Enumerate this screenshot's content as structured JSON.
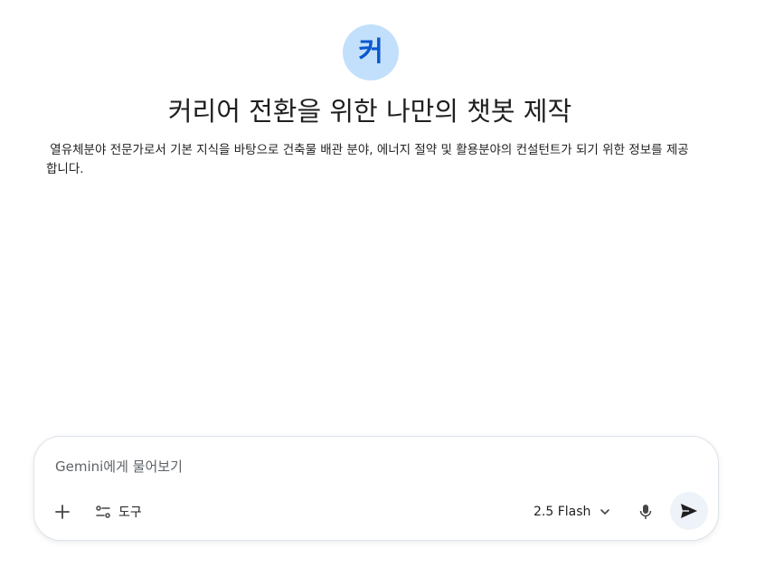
{
  "gem": {
    "avatar_letter": "커",
    "title": "커리어 전환을 위한 나만의 챗봇 제작",
    "description": " 열유체분야 전문가로서 기본 지식을 바탕으로 건축물 배관 분야, 에너지 절약 및 활용분야의 컨설턴트가 되기 위한 정보를 제공합니다.",
    "avatar_color": "#c2e0fb",
    "avatar_text_color": "#0b57d0"
  },
  "composer": {
    "placeholder": "Gemini에게 물어보기",
    "add_icon": "plus-icon",
    "tools_icon": "tune-icon",
    "tools_label": "도구",
    "model_label": "2.5 Flash",
    "model_icon": "chevron-down-icon",
    "mic_icon": "mic-icon",
    "send_icon": "send-icon"
  }
}
